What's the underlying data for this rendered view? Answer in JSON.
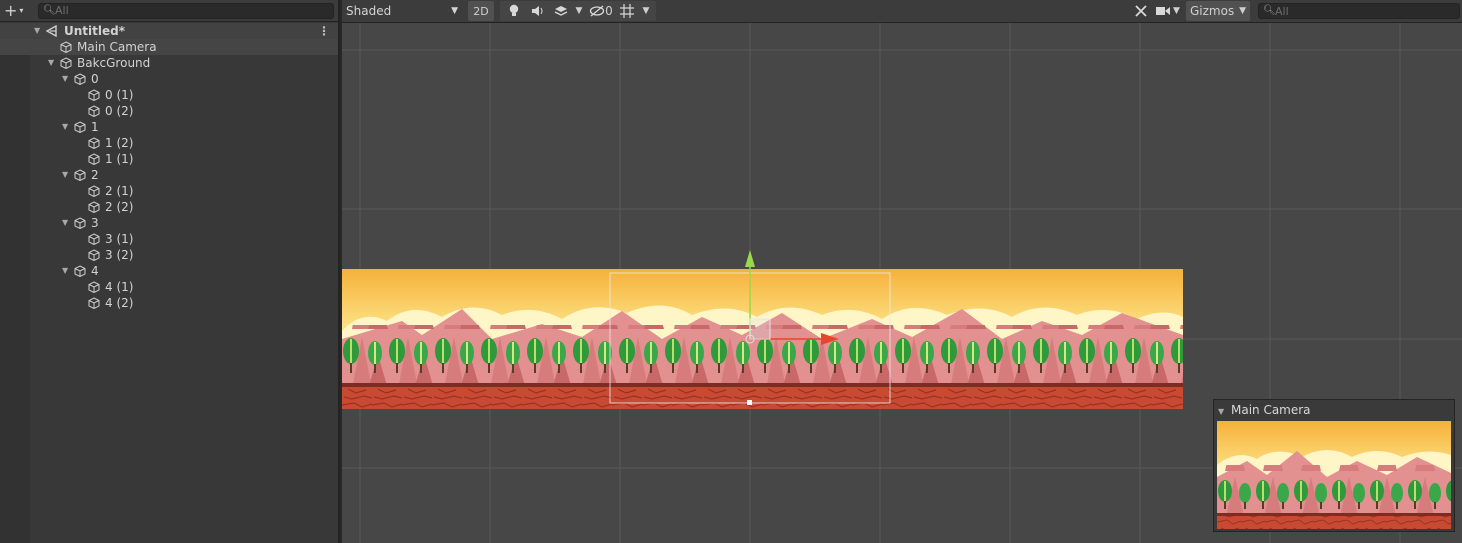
{
  "hierarchy": {
    "add_glyph": "+",
    "dropdown_glyph": "▾",
    "search_placeholder": "All",
    "scene_name": "Untitled*",
    "more_glyph": "⋮",
    "items": [
      {
        "label": "Main Camera"
      },
      {
        "label": "BakcGround"
      },
      {
        "label": "0"
      },
      {
        "label": "0 (1)"
      },
      {
        "label": "0 (2)"
      },
      {
        "label": "1"
      },
      {
        "label": "1 (2)"
      },
      {
        "label": "1 (1)"
      },
      {
        "label": "2"
      },
      {
        "label": "2 (1)"
      },
      {
        "label": "2 (2)"
      },
      {
        "label": "3"
      },
      {
        "label": "3 (1)"
      },
      {
        "label": "3 (2)"
      },
      {
        "label": "4"
      },
      {
        "label": "4 (1)"
      },
      {
        "label": "4 (2)"
      }
    ]
  },
  "scene_toolbar": {
    "shading_mode": "Shaded",
    "mode_2d": "2D",
    "hidden_count": "0",
    "gizmos_label": "Gizmos",
    "search_placeholder": "All"
  },
  "camera_preview": {
    "title": "Main Camera"
  },
  "colors": {
    "panel_bg": "#383838",
    "scene_bg": "#474747",
    "gizmo_y": "#9bd94a",
    "gizmo_x": "#e8462c",
    "sky_top": "#f6b13a",
    "ground": "#c84a32"
  },
  "icons": {
    "add": "plus-icon",
    "search": "search-icon",
    "scene": "unity-scene-icon",
    "gameobject": "cube-icon",
    "lighting": "light-bulb-icon",
    "audio": "speaker-icon",
    "effects": "layers-icon",
    "visibility": "eye-slash-icon",
    "grid": "grid-icon",
    "tools": "tools-icon",
    "camera": "camera-icon"
  }
}
